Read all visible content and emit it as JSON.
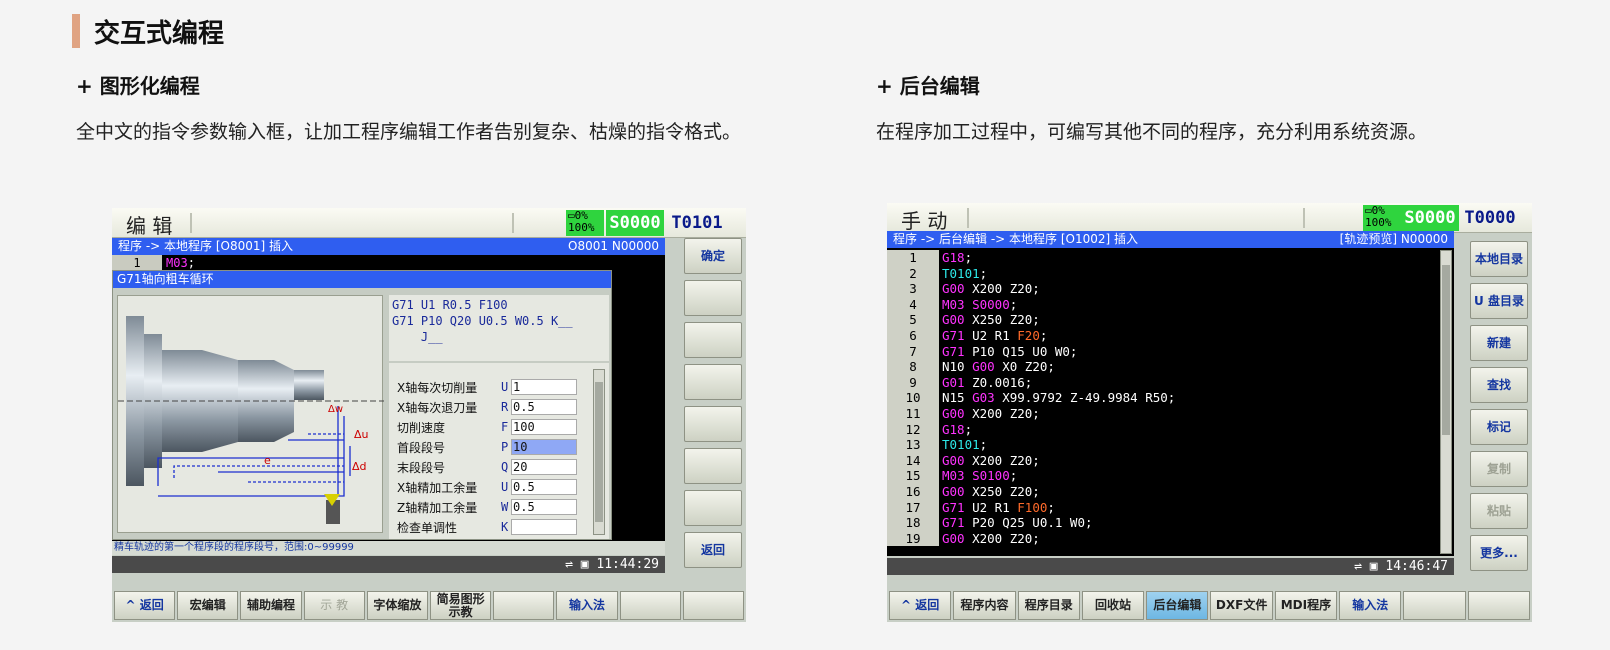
{
  "section": {
    "title": "交互式编程"
  },
  "features": [
    {
      "title": "+ 图形化编程",
      "desc": "全中文的指令参数输入框，让加工程序编辑工作者告别复杂、枯燥的指令格式。"
    },
    {
      "title": "+ 后台编辑",
      "desc": "在程序加工过程中，可编写其他不同的程序，充分利用系统资源。"
    }
  ],
  "left_screen": {
    "mode": "编 辑",
    "load": "0%",
    "override": "100%",
    "spindle": "S0000",
    "tool": "T0101",
    "path": "程序 -> 本地程序 [O8001]  插入",
    "path_right": "O8001 N00000",
    "line1_no": "1",
    "line1_code": "M03",
    "line1_end": ";",
    "dialog_title": "G71轴向粗车循环",
    "g71_line1": "G71 U1 R0.5 F100",
    "g71_line2": "G71 P10 Q20 U0.5 W0.5 K__",
    "g71_line3": "    J__",
    "diagram_labels": {
      "dw": "Δw",
      "du": "Δu",
      "d": "Δd",
      "e": "e"
    },
    "form": [
      {
        "label": "X轴每次切削量",
        "prefix": "U",
        "value": "1"
      },
      {
        "label": "X轴每次退刀量",
        "prefix": "R",
        "value": "0.5"
      },
      {
        "label": "切削速度",
        "prefix": "F",
        "value": "100"
      },
      {
        "label": "首段段号",
        "prefix": "P",
        "value": "10"
      },
      {
        "label": "末段段号",
        "prefix": "Q",
        "value": "20"
      },
      {
        "label": "X轴精加工余量",
        "prefix": "U",
        "value": "0.5"
      },
      {
        "label": "Z轴精加工余量",
        "prefix": "W",
        "value": "0.5"
      },
      {
        "label": "检查单调性",
        "prefix": "K",
        "value": ""
      }
    ],
    "hint": "精车轨迹的第一个程序段的程序段号，范围:0~99999",
    "time": "11:44:29",
    "side_buttons": [
      "确定",
      "",
      "",
      "",
      "",
      "",
      "",
      "返回"
    ],
    "bottom_buttons": [
      "^ 返回",
      "宏编辑",
      "辅助编程",
      "示 教",
      "字体缩放",
      "简易图形示教",
      "",
      "输入法",
      "",
      ""
    ]
  },
  "right_screen": {
    "mode": "手 动",
    "load": "0%",
    "override": "100%",
    "spindle": "S0000",
    "tool": "T0000",
    "path": "程序 -> 后台编辑 -> 本地程序  [O1002]  插入",
    "path_right": "[轨迹预览] N00000",
    "code_lines": [
      [
        "1",
        "G18",
        ";"
      ],
      [
        "2",
        "T0101",
        ";"
      ],
      [
        "3",
        "G00",
        " X200 Z20;"
      ],
      [
        "4",
        "M03 S0000",
        ";"
      ],
      [
        "5",
        "G00",
        " X250 Z20;"
      ],
      [
        "6",
        "G71",
        " U2 R1 ",
        "F20",
        ";"
      ],
      [
        "7",
        "G71",
        " P10 Q15 U0 W0;"
      ],
      [
        "8",
        "N10 ",
        "G00",
        " X0 Z20;"
      ],
      [
        "9",
        "G01",
        " Z0.0016;"
      ],
      [
        "10",
        "N15 ",
        "G03",
        " X99.9792 Z-49.9984 R50;"
      ],
      [
        "11",
        "G00",
        " X200 Z20;"
      ],
      [
        "12",
        "G18",
        ";"
      ],
      [
        "13",
        "T0101",
        ";"
      ],
      [
        "14",
        "G00",
        " X200 Z20;"
      ],
      [
        "15",
        "M03 S0100",
        ";"
      ],
      [
        "16",
        "G00",
        " X250 Z20;"
      ],
      [
        "17",
        "G71",
        " U2 R1 ",
        "F100",
        ";"
      ],
      [
        "18",
        "G71",
        " P20 Q25 U0.1 W0;"
      ],
      [
        "19",
        "G00",
        " X200 Z20;"
      ]
    ],
    "time": "14:46:47",
    "side_buttons": [
      "本地目录",
      "U 盘目录",
      "新建",
      "查找",
      "标记",
      "复制",
      "粘贴",
      "更多..."
    ],
    "bottom_buttons": [
      "^ 返回",
      "程序内容",
      "程序目录",
      "回收站",
      "后台编辑",
      "DXF文件",
      "MDI程序",
      "输入法",
      "",
      ""
    ]
  },
  "colors": {
    "accent": "#e0a382",
    "path_blue": "#2f5ef0",
    "green": "#2fd43e",
    "magenta": "#ff33ff"
  }
}
